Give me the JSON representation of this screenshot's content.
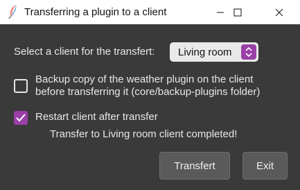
{
  "window": {
    "title": "Transferring a plugin to a client",
    "app_icon": "feather-icon",
    "controls": [
      "minimize-icon",
      "maximize-icon",
      "close-icon"
    ]
  },
  "client_select": {
    "label": "Select a client for the transfert:",
    "value": "Living room"
  },
  "options": {
    "backup": {
      "checked": false,
      "label_line1": "Backup copy of the weather plugin on the client",
      "label_line2": "before transferring it (core/backup-plugins folder)"
    },
    "restart": {
      "checked": true,
      "label": "Restart client after transfer"
    }
  },
  "status": "Transfer to Living room client completed!",
  "buttons": {
    "transfert": "Transfert",
    "exit": "Exit"
  },
  "colors": {
    "background": "#3a3a3a",
    "accent": "#9a3fa8",
    "button": "#5a5a5a",
    "titlebar": "#ffffff"
  }
}
